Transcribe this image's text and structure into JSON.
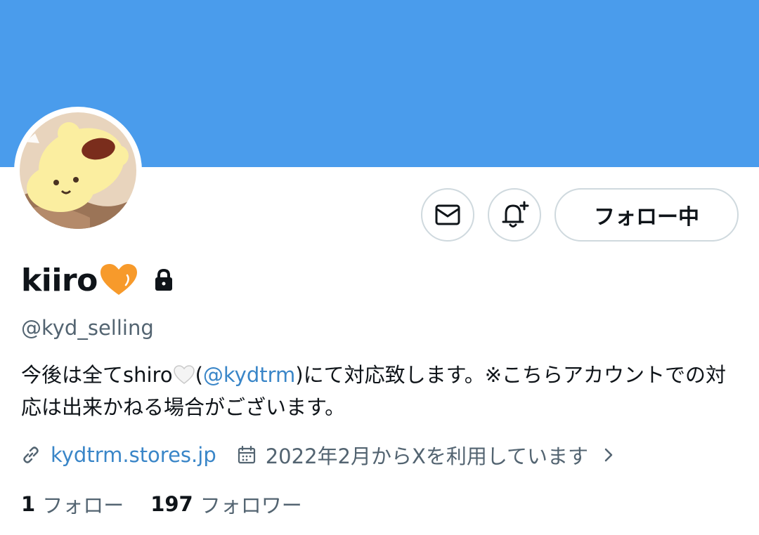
{
  "colors": {
    "banner": "#4a9cec",
    "accent_link": "#3a86c8",
    "secondary_text": "#536471",
    "heart_orange": "#f79a2b",
    "border": "#cfd9de"
  },
  "profile": {
    "display_name": "kiiro",
    "name_emoji": "orange-heart",
    "protected_icon": "lock-icon",
    "handle": "@kyd_selling",
    "bio_before": "今後は全てshiro",
    "bio_emoji": "white-heart",
    "bio_paren_open": "(",
    "bio_mention": "@kydtrm",
    "bio_after": ")にて対応致します。※こちらアカウントでの対応は出来かねる場合がございます。",
    "website": "kydtrm.stores.jp",
    "joined": "2022年2月からXを利用しています"
  },
  "actions": {
    "message_icon": "mail-icon",
    "notify_icon": "bell-plus-icon",
    "follow_label": "フォロー中"
  },
  "stats": {
    "following_count": "1",
    "following_label": "フォロー",
    "followers_count": "197",
    "followers_label": "フォロワー"
  }
}
